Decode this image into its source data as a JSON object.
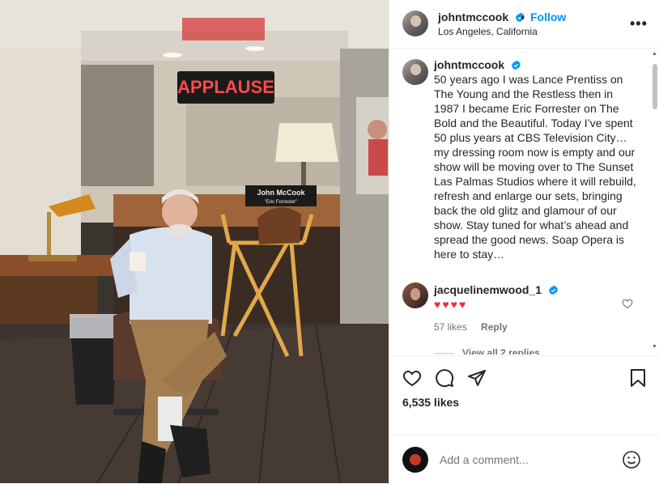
{
  "post": {
    "author": "johntmccook",
    "location": "Los Angeles, California",
    "follow_label": "Follow",
    "separator": "•",
    "more_label": "•••"
  },
  "photo": {
    "sign_text": "APPLAUSE",
    "chair_name": "John McCook",
    "chair_subtitle": "\"Eric Forrester\""
  },
  "caption": {
    "author": "johntmccook",
    "text": "50 years ago I was Lance Prentiss on The Young and the Restless then in 1987 I became Eric Forrester on The Bold and the Beautiful. Today I’ve spent 50 plus years at CBS Television City…my dressing room now is empty and our show will be moving over to The Sunset Las Palmas Studios where it will rebuild, refresh and enlarge our sets, bringing back the old glitz and glamour of our show. Stay tuned for what’s ahead and spread the good news. Soap Opera is here to stay…"
  },
  "comment": {
    "author": "jacquelinemwood_1",
    "hearts": "♥♥♥♥",
    "likes": "57 likes",
    "reply_label": "Reply",
    "view_replies": "View all 2 replies"
  },
  "stats": {
    "likes": "6,535 likes"
  },
  "add_comment": {
    "placeholder": "Add a comment..."
  },
  "colors": {
    "link_blue": "#0095f6",
    "heart_red": "#ed2d45",
    "muted": "#737373"
  },
  "icons": [
    "verified-icon",
    "heart-icon",
    "comment-icon",
    "share-icon",
    "bookmark-icon",
    "emoji-icon",
    "more-icon"
  ]
}
